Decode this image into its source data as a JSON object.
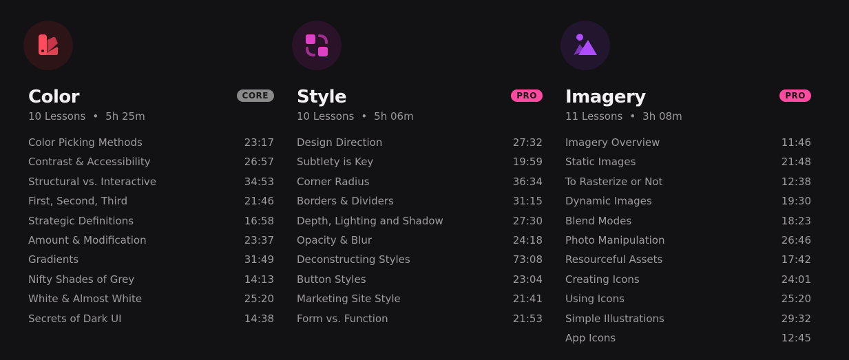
{
  "colors": {
    "background": "#121113",
    "core_badge": "#8a8a8a",
    "pro_badge": "#ff4aa0",
    "color_icon": "#ff4b5c",
    "style_icon": "#e040c8",
    "imagery_icon": "#b04cff"
  },
  "courses": [
    {
      "icon": "swatch-book-icon",
      "title": "Color",
      "badge": "CORE",
      "lessons_count": "10 Lessons",
      "dot": "•",
      "total_duration": "5h 25m",
      "lessons": [
        {
          "title": "Color Picking Methods",
          "duration": "23:17"
        },
        {
          "title": "Contrast & Accessibility",
          "duration": "26:57"
        },
        {
          "title": "Structural vs. Interactive",
          "duration": "34:53"
        },
        {
          "title": "First, Second, Third",
          "duration": "21:46"
        },
        {
          "title": "Strategic Definitions",
          "duration": "16:58"
        },
        {
          "title": "Amount & Modification",
          "duration": "23:37"
        },
        {
          "title": "Gradients",
          "duration": "31:49"
        },
        {
          "title": "Nifty Shades of Grey",
          "duration": "14:13"
        },
        {
          "title": "White & Almost White",
          "duration": "25:20"
        },
        {
          "title": "Secrets of Dark UI",
          "duration": "14:38"
        }
      ]
    },
    {
      "icon": "shapes-icon",
      "title": "Style",
      "badge": "PRO",
      "lessons_count": "10 Lessons",
      "dot": "•",
      "total_duration": "5h 06m",
      "lessons": [
        {
          "title": "Design Direction",
          "duration": "27:32"
        },
        {
          "title": "Subtlety is Key",
          "duration": "19:59"
        },
        {
          "title": "Corner Radius",
          "duration": "36:34"
        },
        {
          "title": "Borders & Dividers",
          "duration": "31:15"
        },
        {
          "title": "Depth, Lighting and Shadow",
          "duration": "27:30"
        },
        {
          "title": "Opacity & Blur",
          "duration": "24:18"
        },
        {
          "title": "Deconstructing Styles",
          "duration": "73:08"
        },
        {
          "title": "Button Styles",
          "duration": "23:04"
        },
        {
          "title": "Marketing Site Style",
          "duration": "21:41"
        },
        {
          "title": "Form vs. Function",
          "duration": "21:53"
        }
      ]
    },
    {
      "icon": "image-icon",
      "title": "Imagery",
      "badge": "PRO",
      "lessons_count": "11 Lessons",
      "dot": "•",
      "total_duration": "3h 08m",
      "lessons": [
        {
          "title": "Imagery Overview",
          "duration": "11:46"
        },
        {
          "title": "Static Images",
          "duration": "21:48"
        },
        {
          "title": "To Rasterize or Not",
          "duration": "12:38"
        },
        {
          "title": "Dynamic Images",
          "duration": "19:30"
        },
        {
          "title": "Blend Modes",
          "duration": "18:23"
        },
        {
          "title": "Photo Manipulation",
          "duration": "26:46"
        },
        {
          "title": "Resourceful Assets",
          "duration": "17:42"
        },
        {
          "title": "Creating Icons",
          "duration": "24:01"
        },
        {
          "title": "Using Icons",
          "duration": "25:20"
        },
        {
          "title": "Simple Illustrations",
          "duration": "29:32"
        },
        {
          "title": "App Icons",
          "duration": "12:45"
        }
      ]
    }
  ]
}
